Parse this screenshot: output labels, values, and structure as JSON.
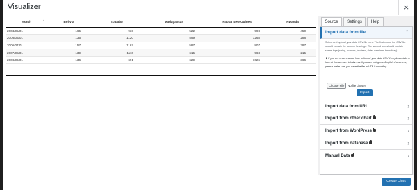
{
  "modal": {
    "title": "Visualizer",
    "close_label": "×"
  },
  "table": {
    "columns": [
      "Month",
      "Bolivia",
      "Ecuador",
      "Madagascar",
      "Papua New Guinea",
      "Rwanda"
    ],
    "rows": [
      [
        "2004/05/01",
        "165",
        "938",
        "522",
        "998",
        "450"
      ],
      [
        "2005/06/01",
        "135",
        "1120",
        "599",
        "1268",
        "288"
      ],
      [
        "2006/07/01",
        "157",
        "1167",
        "587",
        "807",
        "397"
      ],
      [
        "2007/08/01",
        "139",
        "1110",
        "615",
        "968",
        "215"
      ],
      [
        "2008/09/01",
        "136",
        "691",
        "629",
        "1026",
        "366"
      ]
    ],
    "sort_icon": "▲"
  },
  "sidebar": {
    "tabs": [
      "Source",
      "Settings",
      "Help"
    ],
    "active_tab": "Source",
    "import_file": {
      "heading": "Import data from file",
      "description": "Select and upload your data CSV file here. The first row of the CSV file should contain the column headings. The second one should contain series type (string, number, boolean, date, datetime, timeofday).",
      "note_prefix": "If you are unsure about how to format your data CSV then please take a look at this sample: ",
      "note_link": "tabular.csv",
      "note_suffix": ". If you are using non-English characters, please make sure you save the file in UTF-8 encoding.",
      "choose_label": "Choose File",
      "no_file_label": "No file chosen",
      "import_label": "Import"
    },
    "sections": [
      {
        "label": "Import data from URL",
        "locked": false
      },
      {
        "label": "Import from other chart",
        "locked": true
      },
      {
        "label": "Import from WordPress",
        "locked": true
      },
      {
        "label": "Import from database",
        "locked": true
      },
      {
        "label": "Manual Data",
        "locked": true
      }
    ]
  },
  "footer": {
    "create_label": "Create Chart"
  },
  "colors": {
    "accent": "#2271b1",
    "panel_bg": "#f0f0f1",
    "backdrop": "#1f1f1f"
  }
}
